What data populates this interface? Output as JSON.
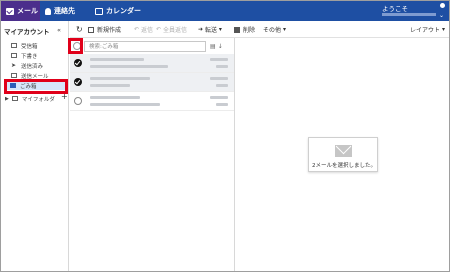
{
  "topbar": {
    "tabs": [
      {
        "label": "メール",
        "icon": "mail-icon"
      },
      {
        "label": "連絡先",
        "icon": "user-icon"
      },
      {
        "label": "カレンダー",
        "icon": "calendar-icon"
      }
    ],
    "welcome": "ようこそ",
    "colors": {
      "bar": "#1e4fa3",
      "active_tab": "#4b2e8c"
    }
  },
  "sidebar": {
    "account": "マイアカウント",
    "collapse": "«",
    "folders": [
      {
        "label": "受信箱",
        "icon": "inbox-icon"
      },
      {
        "label": "下書き",
        "icon": "draft-icon"
      },
      {
        "label": "送信済み",
        "icon": "sent-icon"
      },
      {
        "label": "送信メール",
        "icon": "outbox-icon"
      },
      {
        "label": "ごみ箱",
        "icon": "trash-icon",
        "selected": true
      },
      {
        "label": "マイフォルダ",
        "icon": "folder-icon"
      }
    ],
    "add": "+"
  },
  "toolbar": {
    "refresh": "↻",
    "new": "新規作成",
    "reply": "返信",
    "reply_all": "全員返信",
    "forward": "転送",
    "delete": "削除",
    "other": "その他",
    "layout": "レイアウト"
  },
  "list": {
    "search_placeholder": "検索:ごみ箱",
    "icons": "▤ ↓",
    "rows": [
      {
        "checked": true,
        "selected": true
      },
      {
        "checked": true,
        "selected": true
      },
      {
        "checked": false,
        "selected": false
      }
    ]
  },
  "detail": {
    "message": "2メールを選択しました。"
  }
}
